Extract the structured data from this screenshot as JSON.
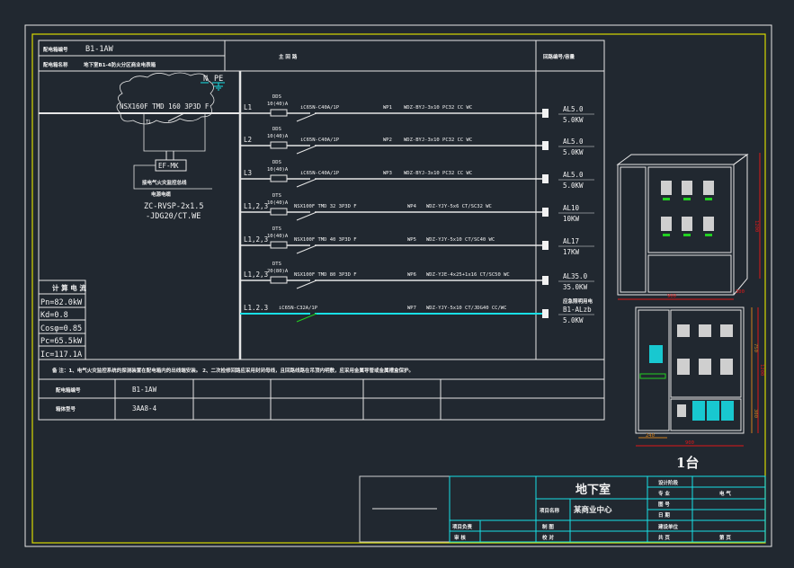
{
  "colors": {
    "background": "#212830",
    "frame": "#d8d800",
    "lines": "#e6e6e6",
    "title_block": "#18e0e6",
    "dimension": "#e01818",
    "breaker_wp7": "#22d022"
  },
  "panel": {
    "code_label": "配电箱编号",
    "code": "B1-1AW",
    "name_label": "配电箱名称",
    "name": "地下室B1-4防火分区商业电表箱",
    "main_header": "主 回 路",
    "right_header": "回路编号/容量",
    "n_label": "N",
    "pe_label": "PE",
    "incoming_breaker": "NSX160F TMD 160 3P3D F",
    "tl_label": "TL",
    "ef_module": "EF-MK",
    "ef_note": "接电气火灾监控总线",
    "cable_label": "电源电缆",
    "cable_spec_1": "ZC-RVSP-2x1.5",
    "cable_spec_2": "-JDG20/CT.WE"
  },
  "circuits": [
    {
      "phase": "L1",
      "meter": "DDS",
      "rating": "10(40)A",
      "breaker": "iC65N-C40A/1P",
      "id": "WP1",
      "cable": "WDZ-BYJ-3x10 PC32 CC WC",
      "load": "AL5.0",
      "power": "5.0KW"
    },
    {
      "phase": "L2",
      "meter": "DDS",
      "rating": "10(40)A",
      "breaker": "iC65N-C40A/1P",
      "id": "WP2",
      "cable": "WDZ-BYJ-3x10 PC32 CC WC",
      "load": "AL5.0",
      "power": "5.0KW"
    },
    {
      "phase": "L3",
      "meter": "DDS",
      "rating": "10(40)A",
      "breaker": "iC65N-C40A/1P",
      "id": "WP3",
      "cable": "WDZ-BYJ-3x10 PC32 CC WC",
      "load": "AL5.0",
      "power": "5.0KW"
    },
    {
      "phase": "L1,2,3",
      "meter": "DTS",
      "rating": "10(40)A",
      "breaker": "NSX100F TMD 32 3P3D F",
      "id": "WP4",
      "cable": "WDZ-YJY-5x6 CT/SC32 WC",
      "load": "AL10",
      "power": "10KW"
    },
    {
      "phase": "L1,2,3",
      "meter": "DTS",
      "rating": "10(40)A",
      "breaker": "NSX100F TMD 40 3P3D F",
      "id": "WP5",
      "cable": "WDZ-YJY-5x10 CT/SC40 WC",
      "load": "AL17",
      "power": "17KW"
    },
    {
      "phase": "L1,2,3",
      "meter": "DTS",
      "rating": "20(80)A",
      "breaker": "NSX100F TMD 80 3P3D F",
      "id": "WP6",
      "cable": "WDZ-YJE-4x25+1x16 CT/SC50 WC",
      "load": "AL35.0",
      "power": "35.0KW"
    },
    {
      "phase": "L1.2.3",
      "meter": "",
      "rating": "",
      "breaker": "iC65N-C32A/1P",
      "id": "WP7",
      "cable": "WDZ-YJY-5x10 CT/JDG40 CC/WC",
      "load_note": "应急照明用电",
      "load": "B1-ALzb",
      "power": "5.0KW"
    }
  ],
  "calc": {
    "title": "计 算 电 流",
    "rows": [
      "Pn=82.0kW",
      "Kd=0.8",
      "Cosφ=0.85",
      "Pc=65.5kW",
      "Ic=117.1A"
    ]
  },
  "note": "备 注：1、电气火灾监控系统的探测装置在配电箱内的出线端安装。 2、二次检修回路应采用封闭母线，且回路线路在吊顶内明敷，应采用金属导管或金属槽盒保护。",
  "bottom_table": [
    {
      "label": "配电箱编号",
      "value": "B1-1AW"
    },
    {
      "label": "箱体型号",
      "value": "3AA8-4"
    }
  ],
  "cabinet": {
    "dims": {
      "width_top": "900",
      "depth": "300",
      "height_top": "1200",
      "width_bottom": "900",
      "height_bottom": "1200",
      "upper": "750",
      "lower": "300",
      "left_col": "240"
    },
    "quantity": "1台"
  },
  "title_block": {
    "drawing_title": "地下室",
    "project_label": "项目名称",
    "project": "某商业中心",
    "stage_label": "设计阶段",
    "stage": "",
    "discipline_label": "专 业",
    "discipline": "电 气",
    "drawing_no_label": "图 号",
    "date_label": "日 期",
    "pm_label": "项目负责",
    "review_label": "审 核",
    "draw_label": "制 图",
    "check_label": "校 对",
    "client_label": "建设单位",
    "client": "",
    "total_label": "共 页",
    "page_label": "第 页"
  }
}
